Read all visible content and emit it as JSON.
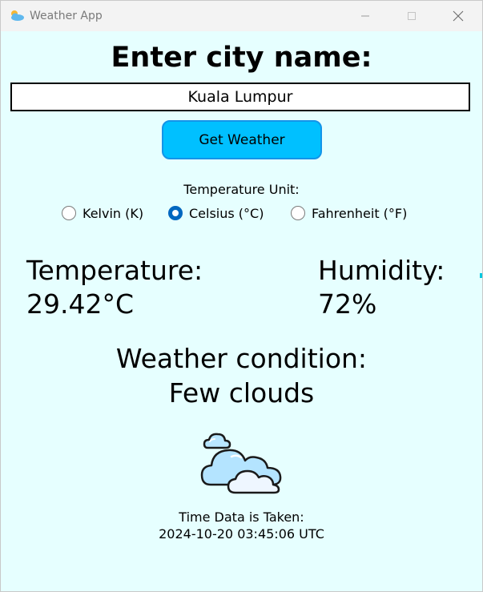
{
  "window": {
    "title": "Weather App",
    "icons": {
      "app": "weather-app-icon",
      "minimize": "minimize-icon",
      "maximize": "maximize-icon",
      "close": "close-icon"
    }
  },
  "form": {
    "heading": "Enter city name:",
    "city_value": "Kuala Lumpur",
    "button_label": "Get Weather"
  },
  "units": {
    "label": "Temperature Unit:",
    "options": [
      {
        "label": "Kelvin (K)",
        "selected": false
      },
      {
        "label": "Celsius (°C)",
        "selected": true
      },
      {
        "label": "Fahrenheit (°F)",
        "selected": false
      }
    ]
  },
  "results": {
    "temperature_label": "Temperature:",
    "temperature_value": "29.42°C",
    "humidity_label": "Humidity:",
    "humidity_value": "72%",
    "condition_label": "Weather condition:",
    "condition_value": "Few clouds",
    "condition_icon": "few-clouds-icon"
  },
  "timestamp": {
    "label": "Time Data is Taken:",
    "value": "2024-10-20 03:45:06 UTC"
  },
  "colors": {
    "background": "#e6ffff",
    "button": "#00c0ff",
    "button_border": "#1494e8",
    "radio_selected": "#0067c0"
  }
}
